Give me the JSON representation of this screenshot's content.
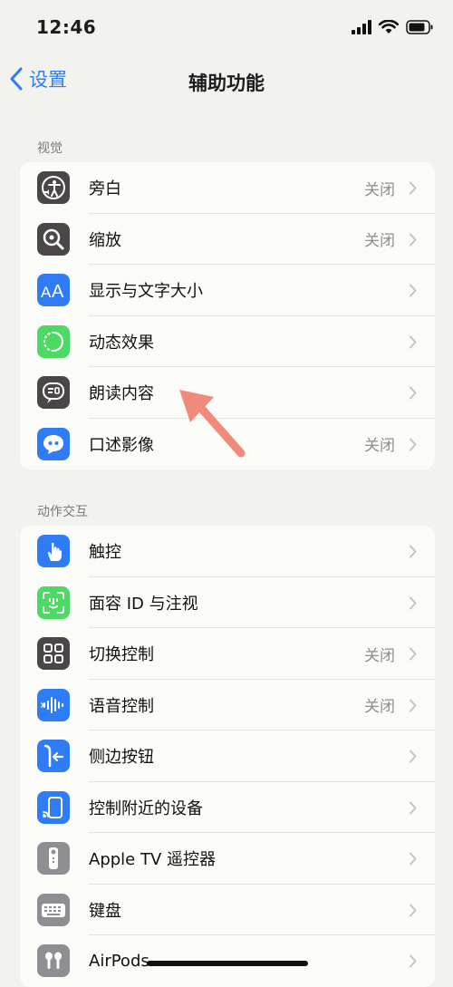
{
  "status": {
    "time": "12:46"
  },
  "nav": {
    "back_label": "设置",
    "title": "辅助功能"
  },
  "sections": [
    {
      "header": "视觉",
      "rows": [
        {
          "label": "旁白",
          "value": "关闭",
          "icon": "voiceover-icon",
          "color": "#4b4749"
        },
        {
          "label": "缩放",
          "value": "关闭",
          "icon": "zoom-icon",
          "color": "#4b4749"
        },
        {
          "label": "显示与文字大小",
          "value": "",
          "icon": "text-size-icon",
          "color": "#2f7cf6"
        },
        {
          "label": "动态效果",
          "value": "",
          "icon": "motion-icon",
          "color": "#4cd964"
        },
        {
          "label": "朗读内容",
          "value": "",
          "icon": "spoken-content-icon",
          "color": "#4b4749"
        },
        {
          "label": "口述影像",
          "value": "关闭",
          "icon": "audio-description-icon",
          "color": "#2f7cf6"
        }
      ]
    },
    {
      "header": "动作交互",
      "rows": [
        {
          "label": "触控",
          "value": "",
          "icon": "touch-icon",
          "color": "#2f7cf6"
        },
        {
          "label": "面容 ID 与注视",
          "value": "",
          "icon": "face-id-icon",
          "color": "#4cd964"
        },
        {
          "label": "切换控制",
          "value": "关闭",
          "icon": "switch-control-icon",
          "color": "#4b4749"
        },
        {
          "label": "语音控制",
          "value": "关闭",
          "icon": "voice-control-icon",
          "color": "#2f7cf6"
        },
        {
          "label": "侧边按钮",
          "value": "",
          "icon": "side-button-icon",
          "color": "#2f7cf6"
        },
        {
          "label": "控制附近的设备",
          "value": "",
          "icon": "nearby-devices-icon",
          "color": "#2f7cf6"
        },
        {
          "label": "Apple TV 遥控器",
          "value": "",
          "icon": "apple-tv-remote-icon",
          "color": "#8e8e93"
        },
        {
          "label": "键盘",
          "value": "",
          "icon": "keyboard-icon",
          "color": "#8e8e93"
        },
        {
          "label": "AirPods",
          "value": "",
          "icon": "airpods-icon",
          "color": "#8e8e93"
        }
      ]
    }
  ],
  "accent_color": "#2f7cf6",
  "arrow_color": "#f08a7a"
}
